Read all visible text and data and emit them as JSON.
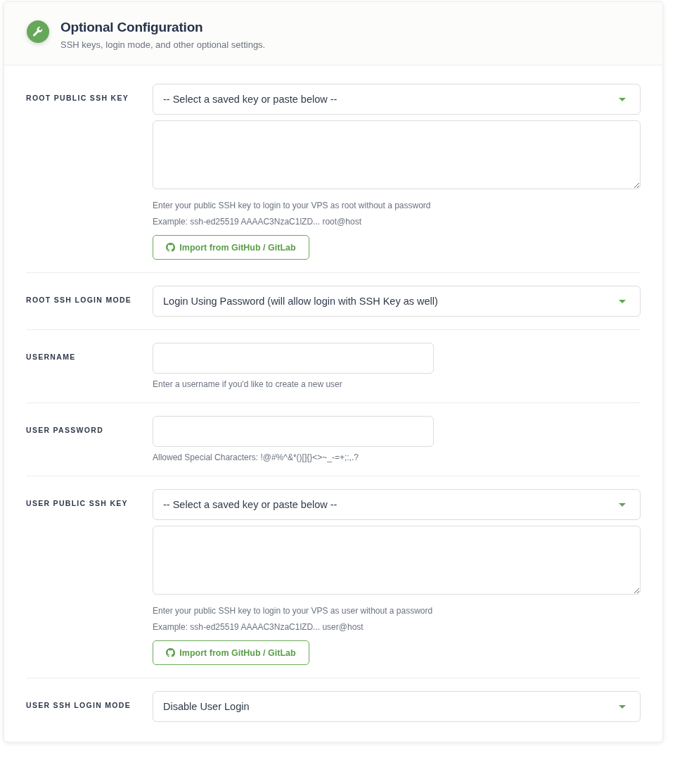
{
  "header": {
    "title": "Optional Configuration",
    "subtitle": "SSH keys, login mode, and other optional settings."
  },
  "fields": [
    {
      "kind": "key",
      "label": "ROOT PUBLIC SSH KEY",
      "select": "-- Select a saved key or paste below --",
      "help": [
        "Enter your public SSH key to login to your VPS as root without a password",
        "Example: ssh-ed25519 AAAAC3NzaC1lZD... root@host"
      ],
      "button": "Import from GitHub / GitLab"
    },
    {
      "kind": "select",
      "label": "ROOT SSH LOGIN MODE",
      "select": "Login Using Password (will allow login with SSH Key as well)"
    },
    {
      "kind": "input",
      "label": "USERNAME",
      "help": [
        "Enter a username if you'd like to create a new user"
      ]
    },
    {
      "kind": "input",
      "label": "USER PASSWORD",
      "help": [
        "Allowed Special Characters: !@#%^&*()[]{}<>~_-=+;:,.?"
      ]
    },
    {
      "kind": "key",
      "label": "USER PUBLIC SSH KEY",
      "select": "-- Select a saved key or paste below --",
      "help": [
        "Enter your public SSH key to login to your VPS as user without a password",
        "Example: ssh-ed25519 AAAAC3NzaC1lZD... user@host"
      ],
      "button": "Import from GitHub / GitLab"
    },
    {
      "kind": "select",
      "label": "USER SSH LOGIN MODE",
      "select": "Disable User Login"
    }
  ]
}
